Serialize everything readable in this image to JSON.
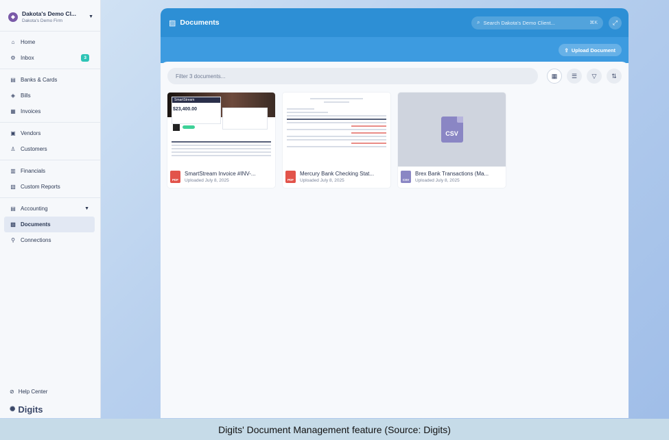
{
  "sidebar": {
    "org_name": "Dakota's Demo Cl...",
    "org_sub": "Dakota's Demo Firm",
    "groups": [
      [
        {
          "label": "Home",
          "icon": "home-icon"
        },
        {
          "label": "Inbox",
          "icon": "inbox-icon",
          "badge": "3"
        }
      ],
      [
        {
          "label": "Banks & Cards",
          "icon": "bank-icon"
        },
        {
          "label": "Bills",
          "icon": "bills-icon"
        },
        {
          "label": "Invoices",
          "icon": "invoice-icon"
        }
      ],
      [
        {
          "label": "Vendors",
          "icon": "vendor-icon"
        },
        {
          "label": "Customers",
          "icon": "customer-icon"
        }
      ],
      [
        {
          "label": "Financials",
          "icon": "financials-icon"
        },
        {
          "label": "Custom Reports",
          "icon": "reports-icon"
        }
      ],
      [
        {
          "label": "Accounting",
          "icon": "accounting-icon"
        },
        {
          "label": "Documents",
          "icon": "documents-icon"
        },
        {
          "label": "Connections",
          "icon": "connections-icon"
        }
      ]
    ],
    "help": "Help Center",
    "logo": "Digits"
  },
  "header": {
    "title": "Documents",
    "search_placeholder": "Search Dakota's Demo Client...",
    "search_shortcut": "⌘K",
    "upload_label": "Upload Document"
  },
  "toolbar": {
    "filter_placeholder": "Filter 3 documents..."
  },
  "documents": [
    {
      "name": "SmartStream Invoice #INV-...",
      "date": "Uploaded July 8, 2025",
      "type": "PDF"
    },
    {
      "name": "Mercury Bank Checking Stat...",
      "date": "Uploaded July 8, 2025",
      "type": "PDF"
    },
    {
      "name": "Brex Bank Transactions (Ma...",
      "date": "Uploaded July 8, 2025",
      "type": "CSV"
    }
  ],
  "thumb": {
    "invoice_amount": "$23,400.00",
    "invoice_brand": "SmartStream",
    "csv_label": "CSV"
  },
  "caption": "Digits' Document Management feature (Source: Digits)",
  "colors": {
    "header_blue": "#2d8fd5",
    "badge_teal": "#2ec4b6",
    "pdf_red": "#e2534a",
    "csv_purple": "#8a86c4"
  }
}
